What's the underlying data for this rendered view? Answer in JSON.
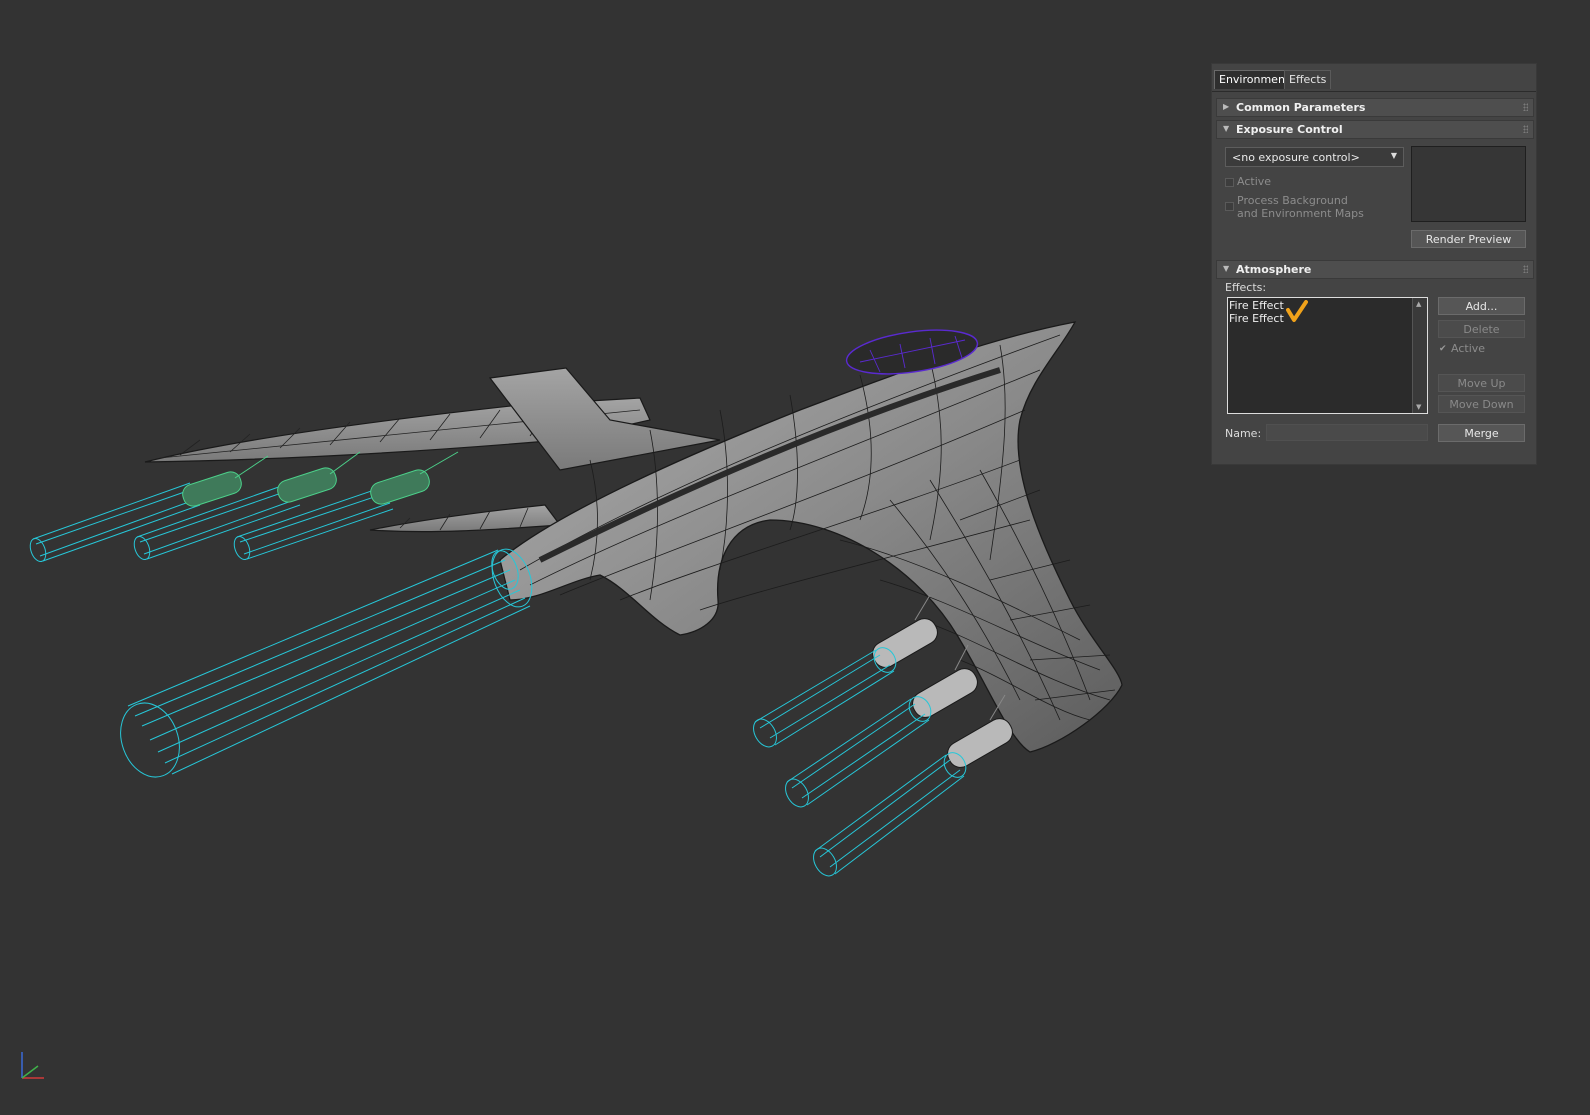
{
  "viewport": {
    "axis_gizmo_icon": "xyz-axis-gizmo-icon",
    "colors": {
      "background": "#333333",
      "mesh_fill": "#8e8e8e",
      "wireframe": "#1a1a1a",
      "fire_gizmo": "#27c7d8",
      "engine_selected": "#4cd08a",
      "cockpit": "#5a2ad0"
    }
  },
  "env_panel": {
    "tabs": [
      {
        "label": "Environment"
      },
      {
        "label": "Effects"
      }
    ],
    "common_parameters": {
      "title": "Common Parameters",
      "expanded": false
    },
    "exposure_control": {
      "title": "Exposure Control",
      "expanded": true,
      "selected_option": "<no exposure control>",
      "active_label": "Active",
      "active_checked": false,
      "process_label_line1": "Process Background",
      "process_label_line2": "and Environment Maps",
      "process_checked": false,
      "render_preview_label": "Render Preview"
    },
    "atmosphere": {
      "title": "Atmosphere",
      "expanded": true,
      "effects_label": "Effects:",
      "effects_list": [
        "Fire Effect",
        "Fire Effect"
      ],
      "checkmark_annotation": "orange-checkmark-icon",
      "add_label": "Add...",
      "delete_label": "Delete",
      "active_label": "Active",
      "active_checked": true,
      "move_up_label": "Move Up",
      "move_down_label": "Move Down",
      "name_label": "Name:",
      "name_value": "",
      "merge_label": "Merge"
    }
  }
}
